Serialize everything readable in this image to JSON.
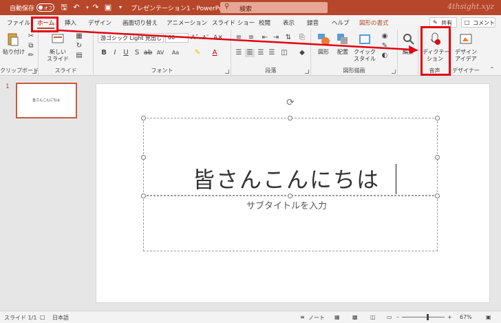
{
  "titlebar": {
    "autosave_label": "自動保存",
    "autosave_state": "オフ",
    "doc_title": "プレゼンテーション1 - PowerPoint",
    "search_placeholder": "検索",
    "watermark": "4thsight.xyz",
    "accent_color": "#b7472a"
  },
  "tabs": [
    "ファイル",
    "ホーム",
    "挿入",
    "デザイン",
    "画面切り替え",
    "アニメーション",
    "スライド ショー",
    "校閲",
    "表示",
    "録音",
    "ヘルプ",
    "図形の書式"
  ],
  "tab_buttons": {
    "share": "共有",
    "comment": "コメント"
  },
  "ribbon": {
    "clipboard": {
      "paste": "貼り付け",
      "label": "クリップボード"
    },
    "slides": {
      "new_slide_line1": "新しい",
      "new_slide_line2": "スライド",
      "label": "スライド"
    },
    "font": {
      "font_name": "游ゴシック Light 見出し",
      "font_size": "60",
      "label": "フォント"
    },
    "paragraph": {
      "label": "段落"
    },
    "drawing": {
      "shape": "図形",
      "arrange": "配置",
      "quick_style_line1": "クイック",
      "quick_style_line2": "スタイル",
      "label": "図形描画"
    },
    "editing": {
      "label": "編集"
    },
    "voice": {
      "dictate_line1": "ディクテー",
      "dictate_line2": "ション",
      "label": "音声"
    },
    "designer": {
      "ideas_line1": "デザイン",
      "ideas_line2": "アイデア",
      "label": "デザイナー"
    }
  },
  "thumbnails": [
    {
      "number": "1",
      "text": "皆さんこんにちは"
    }
  ],
  "slide": {
    "title": "皆さんこんにちは",
    "subtitle_placeholder": "サブタイトルを入力"
  },
  "status": {
    "slide_count": "スライド 1/1",
    "language": "日本語",
    "notes": "ノート",
    "zoom": "67%"
  }
}
